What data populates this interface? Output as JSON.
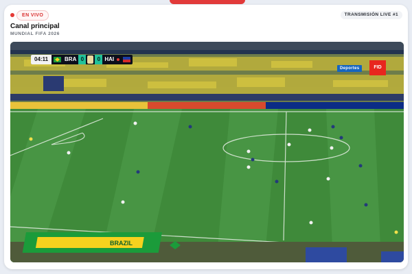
{
  "header": {
    "live_label": "EN VIVO",
    "transmission_badge": "TRANSMISIÓN LIVE #1",
    "title": "Canal principal",
    "subtitle": "MUNDIAL FIFA 2026"
  },
  "scoreboard": {
    "clock": "04:11",
    "home": {
      "team": "BRA",
      "score": "0",
      "flag": "brazil-flag-icon"
    },
    "away": {
      "team": "HAI",
      "score": "0",
      "flag": "haiti-flag-icon"
    }
  },
  "broadcast": {
    "network_logo": "Deportes",
    "channel_logo": "FID",
    "stand_banner": "BRAZIL"
  },
  "colors": {
    "live_red": "#e53935",
    "pitch_green": "#3f8a3a",
    "brazil_yellow": "#f6d21e",
    "brazil_green": "#1b9b3a",
    "score_teal": "#22c19a",
    "network_blue": "#1565c0"
  }
}
